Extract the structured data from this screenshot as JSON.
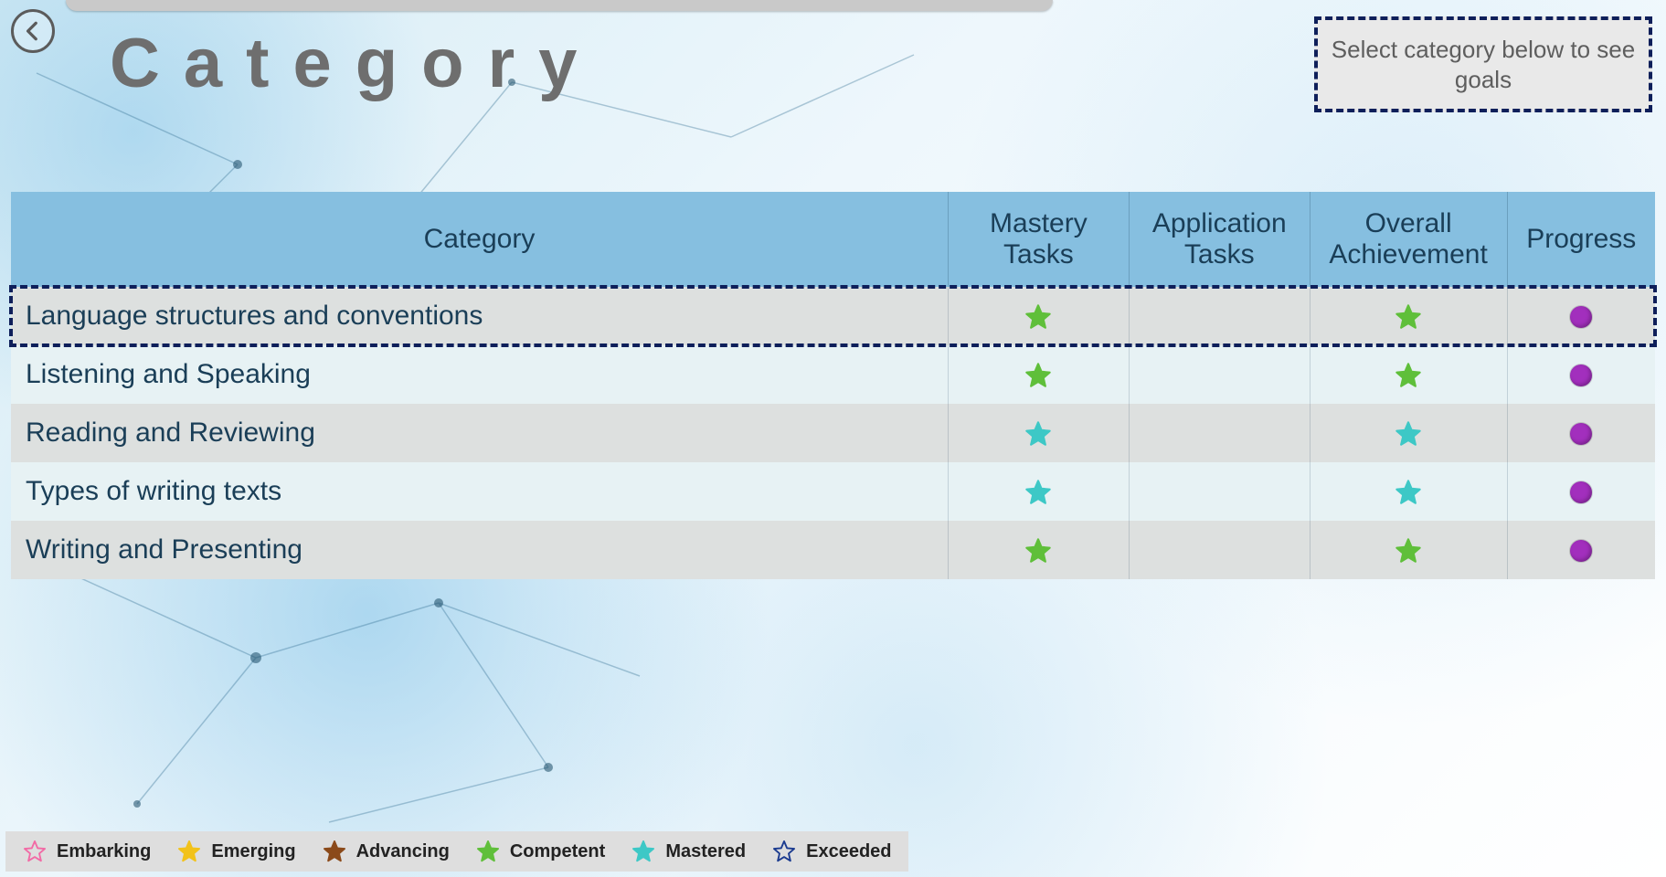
{
  "page_title": "Category",
  "hint": "Select category below to see goals",
  "colors": {
    "header_bg": "#86bfe0",
    "row_odd": "#dde0df",
    "row_even": "#e7f2f4",
    "dash_border": "#0e1f5a",
    "progress_dot": "#a22fbd"
  },
  "star_colors": {
    "embarking": "#f26aa5",
    "emerging": "#f2c21a",
    "advancing": "#8b4a1a",
    "competent": "#5fbf3a",
    "mastered": "#3dc8c6",
    "exceeded": "#1a3a8f"
  },
  "table": {
    "headers": {
      "category": "Category",
      "mastery": "Mastery Tasks",
      "application": "Application Tasks",
      "overall": "Overall Achievement",
      "progress": "Progress"
    },
    "col_widths": {
      "category": "57%",
      "mastery": "11%",
      "application": "11%",
      "overall": "12%",
      "progress": "9%"
    },
    "rows": [
      {
        "name": "Language structures and conventions",
        "mastery_level": "competent",
        "application_level": null,
        "overall_level": "competent",
        "progress": true,
        "highlight": true
      },
      {
        "name": "Listening and Speaking",
        "mastery_level": "competent",
        "application_level": null,
        "overall_level": "competent",
        "progress": true,
        "highlight": false
      },
      {
        "name": "Reading and Reviewing",
        "mastery_level": "mastered",
        "application_level": null,
        "overall_level": "mastered",
        "progress": true,
        "highlight": false
      },
      {
        "name": "Types of writing texts",
        "mastery_level": "mastered",
        "application_level": null,
        "overall_level": "mastered",
        "progress": true,
        "highlight": false
      },
      {
        "name": "Writing and Presenting",
        "mastery_level": "competent",
        "application_level": null,
        "overall_level": "competent",
        "progress": true,
        "highlight": false
      }
    ]
  },
  "legend": [
    {
      "key": "embarking",
      "label": "Embarking",
      "style": "outline"
    },
    {
      "key": "emerging",
      "label": "Emerging",
      "style": "fill"
    },
    {
      "key": "advancing",
      "label": "Advancing",
      "style": "fill"
    },
    {
      "key": "competent",
      "label": "Competent",
      "style": "fill"
    },
    {
      "key": "mastered",
      "label": "Mastered",
      "style": "fill"
    },
    {
      "key": "exceeded",
      "label": "Exceeded",
      "style": "outline"
    }
  ]
}
